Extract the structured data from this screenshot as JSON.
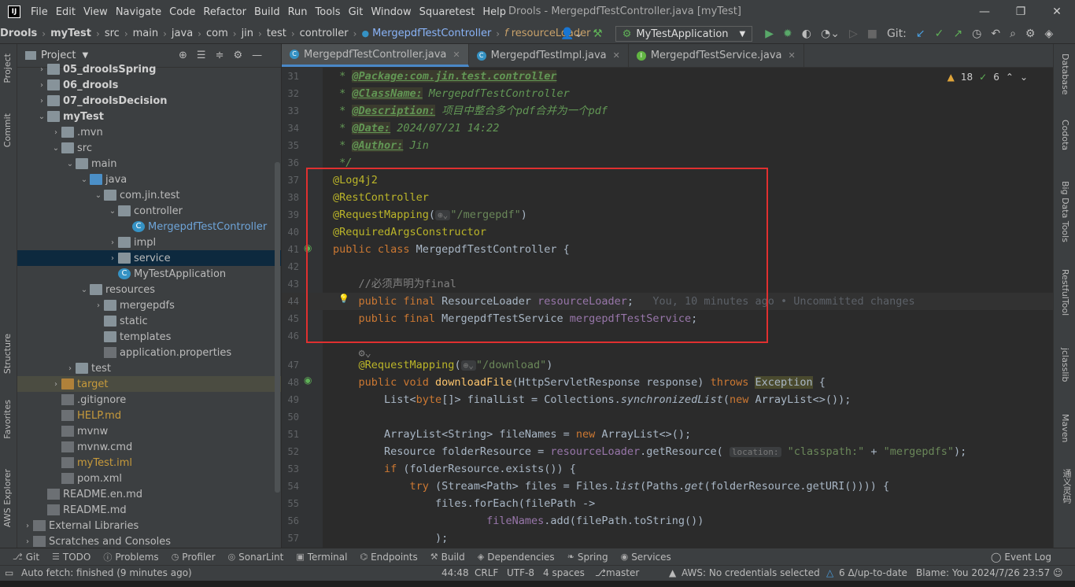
{
  "menubar": {
    "items": [
      "File",
      "Edit",
      "View",
      "Navigate",
      "Code",
      "Refactor",
      "Build",
      "Run",
      "Tools",
      "Git",
      "Window",
      "Squaretest",
      "Help"
    ],
    "window_title": "Drools - MergepdfTestController.java [myTest]"
  },
  "navbar": {
    "crumbs": [
      "Drools",
      "myTest",
      "src",
      "main",
      "java",
      "com",
      "jin",
      "test",
      "controller",
      "MergepdfTestController",
      "resourceLoader"
    ],
    "run_config": "MyTestApplication",
    "git_label": "Git:"
  },
  "left_strip": {
    "tabs": [
      "Project",
      "Commit",
      "Structure",
      "Favorites",
      "AWS Explorer"
    ]
  },
  "project": {
    "title": "Project",
    "tree": [
      {
        "label": "05_droolsSpring",
        "level": 1,
        "icon": "folder",
        "arrow": "›",
        "style": "bold"
      },
      {
        "label": "06_drools",
        "level": 1,
        "icon": "folder",
        "arrow": "›",
        "style": "bold"
      },
      {
        "label": "07_droolsDecision",
        "level": 1,
        "icon": "folder",
        "arrow": "›",
        "style": "bold"
      },
      {
        "label": "myTest",
        "level": 1,
        "icon": "folder",
        "arrow": "⌄",
        "style": "bold"
      },
      {
        "label": ".mvn",
        "level": 2,
        "icon": "folder",
        "arrow": "›",
        "style": ""
      },
      {
        "label": "src",
        "level": 2,
        "icon": "folder",
        "arrow": "⌄",
        "style": ""
      },
      {
        "label": "main",
        "level": 3,
        "icon": "folder",
        "arrow": "⌄",
        "style": ""
      },
      {
        "label": "java",
        "level": 4,
        "icon": "folder-blue",
        "arrow": "⌄",
        "style": ""
      },
      {
        "label": "com.jin.test",
        "level": 5,
        "icon": "folder",
        "arrow": "⌄",
        "style": ""
      },
      {
        "label": "controller",
        "level": 6,
        "icon": "folder",
        "arrow": "⌄",
        "style": ""
      },
      {
        "label": "MergepdfTestController",
        "level": 7,
        "icon": "class",
        "arrow": "",
        "style": "blue"
      },
      {
        "label": "impl",
        "level": 6,
        "icon": "folder",
        "arrow": "›",
        "style": ""
      },
      {
        "label": "service",
        "level": 6,
        "icon": "folder",
        "arrow": "›",
        "style": "",
        "selected": true
      },
      {
        "label": "MyTestApplication",
        "level": 6,
        "icon": "class",
        "arrow": "",
        "style": ""
      },
      {
        "label": "resources",
        "level": 4,
        "icon": "folder",
        "arrow": "⌄",
        "style": ""
      },
      {
        "label": "mergepdfs",
        "level": 5,
        "icon": "folder",
        "arrow": "›",
        "style": ""
      },
      {
        "label": "static",
        "level": 5,
        "icon": "folder",
        "arrow": "",
        "style": ""
      },
      {
        "label": "templates",
        "level": 5,
        "icon": "folder",
        "arrow": "",
        "style": ""
      },
      {
        "label": "application.properties",
        "level": 5,
        "icon": "file",
        "arrow": "",
        "style": ""
      },
      {
        "label": "test",
        "level": 3,
        "icon": "folder",
        "arrow": "›",
        "style": ""
      },
      {
        "label": "target",
        "level": 2,
        "icon": "folder-orange",
        "arrow": "›",
        "style": "orange",
        "highlight": true
      },
      {
        "label": ".gitignore",
        "level": 2,
        "icon": "file",
        "arrow": "",
        "style": ""
      },
      {
        "label": "HELP.md",
        "level": 2,
        "icon": "file",
        "arrow": "",
        "style": "orange"
      },
      {
        "label": "mvnw",
        "level": 2,
        "icon": "file",
        "arrow": "",
        "style": ""
      },
      {
        "label": "mvnw.cmd",
        "level": 2,
        "icon": "file",
        "arrow": "",
        "style": ""
      },
      {
        "label": "myTest.iml",
        "level": 2,
        "icon": "file",
        "arrow": "",
        "style": "orange"
      },
      {
        "label": "pom.xml",
        "level": 2,
        "icon": "file",
        "arrow": "",
        "style": ""
      },
      {
        "label": "README.en.md",
        "level": 1,
        "icon": "file",
        "arrow": "",
        "style": ""
      },
      {
        "label": "README.md",
        "level": 1,
        "icon": "file",
        "arrow": "",
        "style": ""
      },
      {
        "label": "External Libraries",
        "level": 0,
        "icon": "file",
        "arrow": "›",
        "style": ""
      },
      {
        "label": "Scratches and Consoles",
        "level": 0,
        "icon": "file",
        "arrow": "›",
        "style": ""
      }
    ]
  },
  "tabs": [
    {
      "label": "MergepdfTestController.java",
      "active": true,
      "color": "#3592c4"
    },
    {
      "label": "MergepdfTestImpl.java",
      "active": false,
      "color": "#3592c4"
    },
    {
      "label": "MergepdfTestService.java",
      "active": false,
      "color": "#62b543"
    }
  ],
  "inspections": {
    "warnings": "18",
    "weak": "6"
  },
  "code_lines": [
    {
      "n": "31",
      "html": "<span class='doc'> * </span><span class='doctag'>@Package:com.jin.test.controller</span>"
    },
    {
      "n": "32",
      "html": "<span class='doc'> * </span><span class='doctag'>@ClassName:</span><span class='doc'> MergepdfTestController</span>"
    },
    {
      "n": "33",
      "html": "<span class='doc'> * </span><span class='doctag'>@Description:</span><span class='doc'> 项目中整合多个pdf合并为一个pdf</span>"
    },
    {
      "n": "34",
      "html": "<span class='doc'> * </span><span class='doctag'>@Date:</span><span class='doc'> 2024/07/21 14:22</span>"
    },
    {
      "n": "35",
      "html": "<span class='doc'> * </span><span class='doctag'>@Author:</span><span class='doc'> Jin</span>"
    },
    {
      "n": "36",
      "html": "<span class='doc'> */</span>"
    },
    {
      "n": "37",
      "html": "<span class='ann'>@Log4j2</span>"
    },
    {
      "n": "38",
      "html": "<span class='ann'>@RestController</span>"
    },
    {
      "n": "39",
      "html": "<span class='ann'>@RequestMapping</span><span class='plain'>(</span><span class='hint'>⊕⌄</span><span class='str'>\"/mergepdf\"</span><span class='plain'>)</span>"
    },
    {
      "n": "40",
      "html": "<span class='ann'>@RequiredArgsConstructor</span>"
    },
    {
      "n": "41",
      "html": "<span class='k'>public class </span><span class='plain'>MergepdfTestController {</span>"
    },
    {
      "n": "42",
      "html": ""
    },
    {
      "n": "43",
      "html": "<span class='com'>    //必须声明为final</span>"
    },
    {
      "n": "44",
      "html": "<span class='k'>    public final </span><span class='plain'>ResourceLoader </span><span class='field'>resourceLoader</span><span class='plain'>;   </span><span class='blame'>You, 10 minutes ago • Uncommitted changes</span>",
      "current": true
    },
    {
      "n": "45",
      "html": "<span class='k'>    public final </span><span class='plain'>MergepdfTestService </span><span class='field'>mergepdfTestService</span><span class='plain'>;</span>"
    },
    {
      "n": "46",
      "html": ""
    },
    {
      "n": "",
      "html": "<span class='com'>    ⚙⌄</span>"
    },
    {
      "n": "47",
      "html": "<span class='ann'>    @RequestMapping</span><span class='plain'>(</span><span class='hint'>⊕⌄</span><span class='str'>\"/download\"</span><span class='plain'>)</span>"
    },
    {
      "n": "48",
      "html": "<span class='k'>    public void </span><span class='meth'>downloadFile</span><span class='plain'>(HttpServletResponse response) </span><span class='k'>throws </span><span class='exc'>Exception</span><span class='plain'> {</span>"
    },
    {
      "n": "49",
      "html": "<span class='plain'>        List&lt;</span><span class='k'>byte</span><span class='plain'>[]&gt; finalList = Collections.</span><span class='plain ital'>synchronizedList</span><span class='plain'>(</span><span class='k'>new </span><span class='plain'>ArrayList&lt;&gt;());</span>"
    },
    {
      "n": "50",
      "html": ""
    },
    {
      "n": "51",
      "html": "<span class='plain'>        ArrayList&lt;String&gt; fileNames = </span><span class='k'>new </span><span class='plain'>ArrayList&lt;&gt;();</span>"
    },
    {
      "n": "52",
      "html": "<span class='plain'>        Resource folderResource = </span><span class='field'>resourceLoader</span><span class='plain'>.getResource( </span><span class='hint'>location:</span><span class='str'> \"classpath:\"</span><span class='plain'> + </span><span class='str'>\"mergepdfs\"</span><span class='plain'>);</span>"
    },
    {
      "n": "53",
      "html": "<span class='k'>        if </span><span class='plain'>(folderResource.exists()) {</span>"
    },
    {
      "n": "54",
      "html": "<span class='k'>            try </span><span class='plain'>(Stream&lt;Path&gt; files = Files.</span><span class='plain ital'>list</span><span class='plain'>(Paths.</span><span class='plain ital'>get</span><span class='plain'>(folderResource.getURI()))) {</span>"
    },
    {
      "n": "55",
      "html": "<span class='plain'>                files.forEach(filePath -&gt;</span>"
    },
    {
      "n": "56",
      "html": "<span class='plain'>                        </span><span class='field'>fileNames</span><span class='plain'>.add(filePath.toString())</span>"
    },
    {
      "n": "57",
      "html": "<span class='plain'>                );</span>"
    }
  ],
  "right_strip": {
    "tabs": [
      "Database",
      "Codota",
      "Big Data Tools",
      "RestfulTool",
      "jclasslib",
      "Maven",
      "通义灵码"
    ]
  },
  "toolwindows": [
    {
      "icon": "⎇",
      "label": "Git"
    },
    {
      "icon": "☰",
      "label": "TODO"
    },
    {
      "icon": "ⓘ",
      "label": "Problems"
    },
    {
      "icon": "◷",
      "label": "Profiler"
    },
    {
      "icon": "◎",
      "label": "SonarLint"
    },
    {
      "icon": "▣",
      "label": "Terminal"
    },
    {
      "icon": "⌬",
      "label": "Endpoints"
    },
    {
      "icon": "⚒",
      "label": "Build"
    },
    {
      "icon": "◈",
      "label": "Dependencies"
    },
    {
      "icon": "❧",
      "label": "Spring"
    },
    {
      "icon": "◉",
      "label": "Services"
    }
  ],
  "event_log": "Event Log",
  "status": {
    "message": "Auto fetch: finished (9 minutes ago)",
    "position": "44:48",
    "line_sep": "CRLF",
    "encoding": "UTF-8",
    "indent": "4 spaces",
    "branch": "master",
    "aws": "AWS: No credentials selected",
    "git_status": "6 Δ/up-to-date",
    "blame": "Blame: You 2024/7/26 23:57"
  }
}
